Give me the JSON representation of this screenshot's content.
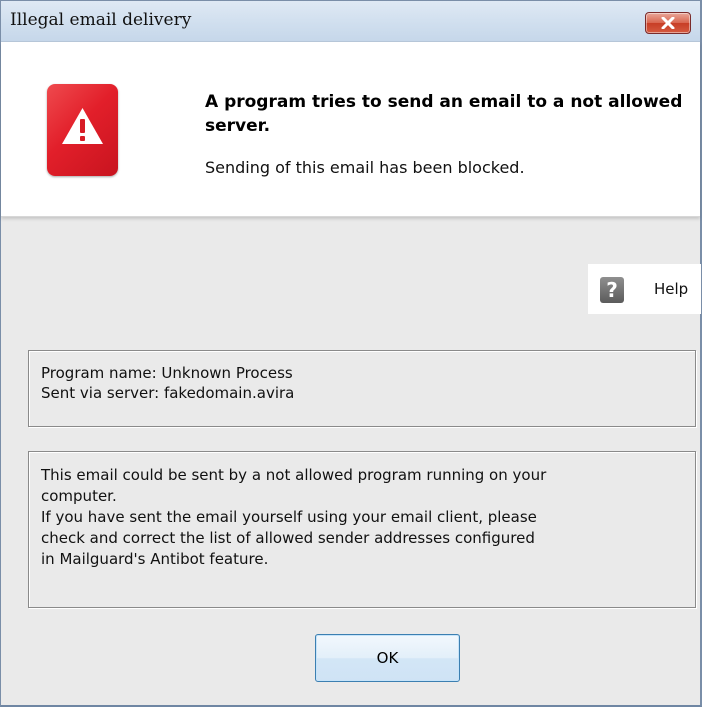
{
  "window": {
    "title": "Illegal email delivery",
    "close_icon": "close-icon"
  },
  "header": {
    "icon": "warning-icon",
    "headline": "A program tries to send an email to a not allowed server.",
    "subline": "Sending of this email has been blocked."
  },
  "help": {
    "icon": "help-icon",
    "label": "Help"
  },
  "details": {
    "program_name": "Program name: Unknown Process",
    "server": "Sent via server: fakedomain.avira"
  },
  "explanation": {
    "line1": "This email could be sent by a not allowed program running on your",
    "line2": "computer.",
    "line3": "If you have sent the email yourself using your email client, please",
    "line4": "check and correct the list of allowed sender addresses configured",
    "line5": "in Mailguard's Antibot feature."
  },
  "buttons": {
    "ok_label": "OK"
  },
  "colors": {
    "accent_red": "#e21f2a",
    "titlebar": "#cfdeee",
    "button_border": "#3c7fb1"
  }
}
